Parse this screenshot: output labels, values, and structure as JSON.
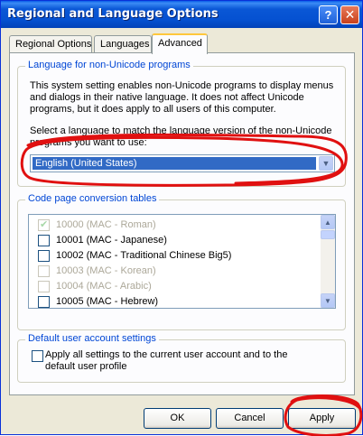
{
  "window": {
    "title": "Regional and Language Options"
  },
  "titlebar": {
    "help_label": "?",
    "close_label": "✕"
  },
  "tabs": [
    {
      "label": "Regional Options"
    },
    {
      "label": "Languages"
    },
    {
      "label": "Advanced"
    }
  ],
  "non_unicode": {
    "group_title": "Language for non-Unicode programs",
    "description": "This system setting enables non-Unicode programs to display menus and dialogs in their native language. It does not affect Unicode programs, but it does apply to all users of this computer.",
    "select_prompt": "Select a language to match the language version of the non-Unicode programs you want to use:",
    "selected_language": "English (United States)"
  },
  "code_pages": {
    "group_title": "Code page conversion tables",
    "items": [
      {
        "label": "10000 (MAC - Roman)",
        "checked": true,
        "disabled": true
      },
      {
        "label": "10001 (MAC - Japanese)",
        "checked": false,
        "disabled": false
      },
      {
        "label": "10002 (MAC - Traditional Chinese Big5)",
        "checked": false,
        "disabled": false
      },
      {
        "label": "10003 (MAC - Korean)",
        "checked": false,
        "disabled": true
      },
      {
        "label": "10004 (MAC - Arabic)",
        "checked": false,
        "disabled": true
      },
      {
        "label": "10005 (MAC - Hebrew)",
        "checked": false,
        "disabled": false
      }
    ]
  },
  "default_user": {
    "group_title": "Default user account settings",
    "checkbox_label": "Apply all settings to the current user account and to the default user profile"
  },
  "buttons": {
    "ok": "OK",
    "cancel": "Cancel",
    "apply": "Apply"
  },
  "colors": {
    "titlebar": "#0a57d6",
    "group_title": "#0046d5",
    "selection": "#316ac5",
    "marker": "#e01010"
  }
}
